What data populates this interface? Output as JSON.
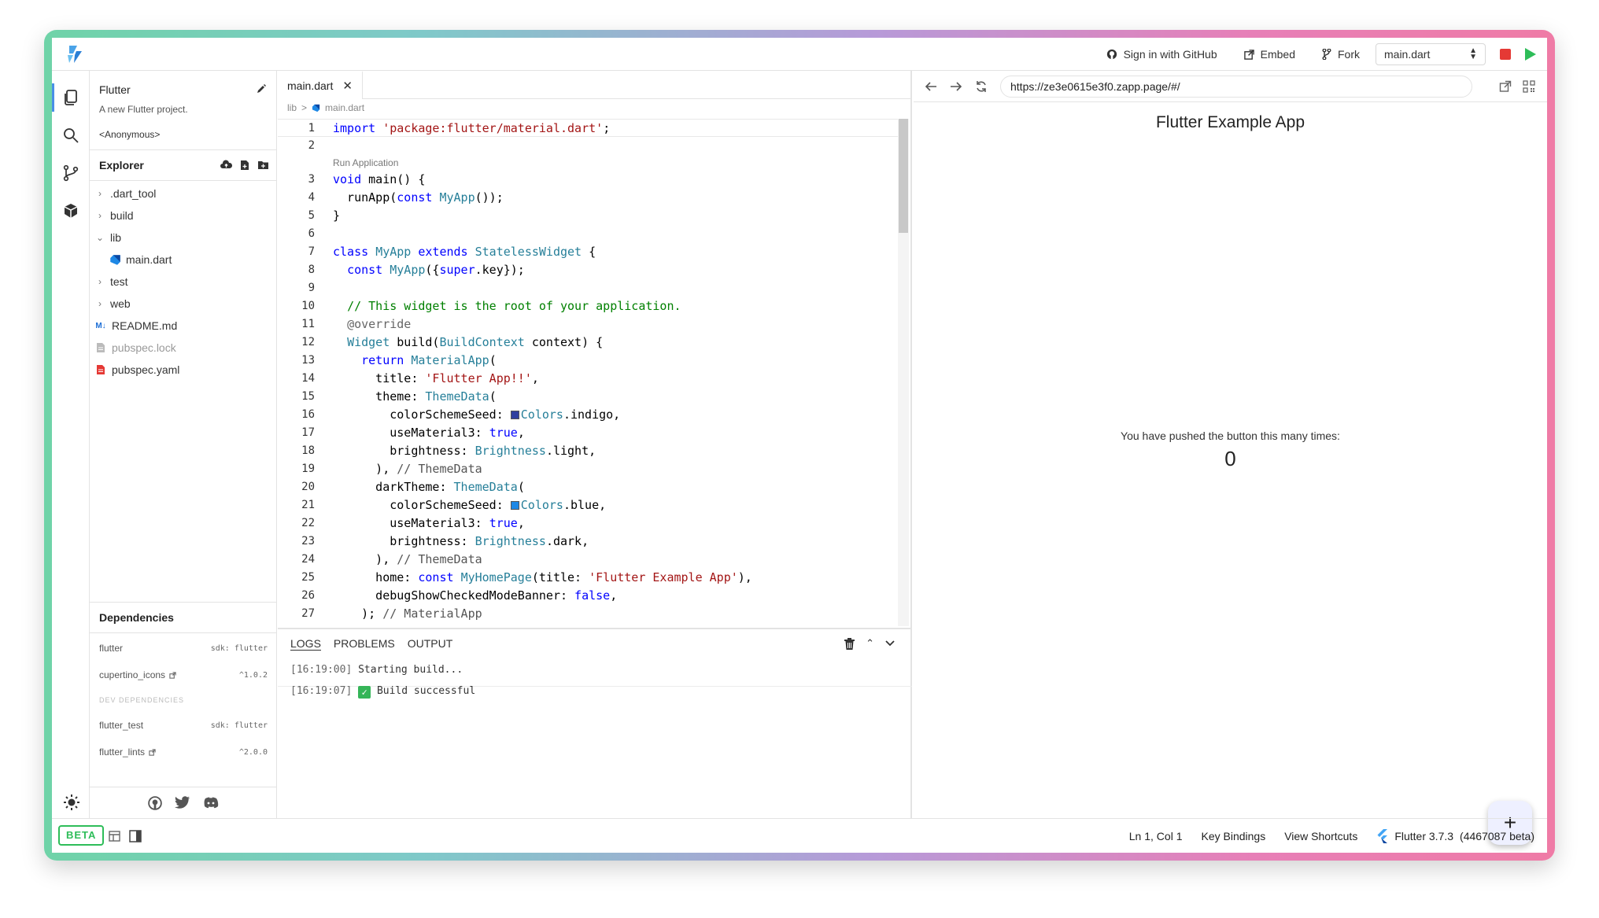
{
  "topbar": {
    "sign_in": "Sign in with GitHub",
    "embed": "Embed",
    "fork": "Fork",
    "file_select": "main.dart"
  },
  "sidebar": {
    "project_name": "Flutter",
    "project_desc": "A new Flutter project.",
    "author": "<Anonymous>",
    "explorer_label": "Explorer",
    "tree": [
      {
        "label": ".dart_tool",
        "kind": "folder",
        "expanded": false,
        "depth": 0,
        "dim": false
      },
      {
        "label": "build",
        "kind": "folder",
        "expanded": false,
        "depth": 0,
        "dim": false
      },
      {
        "label": "lib",
        "kind": "folder",
        "expanded": true,
        "depth": 0,
        "dim": false
      },
      {
        "label": "main.dart",
        "kind": "dart",
        "depth": 1,
        "dim": false
      },
      {
        "label": "test",
        "kind": "folder",
        "expanded": false,
        "depth": 0,
        "dim": false
      },
      {
        "label": "web",
        "kind": "folder",
        "expanded": false,
        "depth": 0,
        "dim": false
      },
      {
        "label": "README.md",
        "kind": "md",
        "depth": 0,
        "dim": false
      },
      {
        "label": "pubspec.lock",
        "kind": "lock",
        "depth": 0,
        "dim": true
      },
      {
        "label": "pubspec.yaml",
        "kind": "yaml",
        "depth": 0,
        "dim": false
      }
    ],
    "dependencies_label": "Dependencies",
    "dependencies": [
      {
        "name": "flutter",
        "version": "sdk: flutter",
        "external": false
      },
      {
        "name": "cupertino_icons",
        "version": "^1.0.2",
        "external": true
      }
    ],
    "dev_dependencies_label": "DEV DEPENDENCIES",
    "dev_dependencies": [
      {
        "name": "flutter_test",
        "version": "sdk: flutter",
        "external": false
      },
      {
        "name": "flutter_lints",
        "version": "^2.0.0",
        "external": true
      }
    ]
  },
  "editor": {
    "tab_label": "main.dart",
    "breadcrumb_folder": "lib",
    "breadcrumb_sep": ">",
    "breadcrumb_file": "main.dart",
    "codelens": "Run Application"
  },
  "panel": {
    "tabs": [
      "LOGS",
      "PROBLEMS",
      "OUTPUT"
    ],
    "logs": [
      {
        "time": "[16:19:00]",
        "text": "Starting build...",
        "check": false
      },
      {
        "time": "[16:19:07]",
        "text": "Build successful",
        "check": true
      }
    ]
  },
  "preview": {
    "url": "https://ze3e0615e3f0.zapp.page/#/",
    "app_title": "Flutter Example App",
    "message": "You have pushed the button this many times:",
    "count": "0",
    "fab_label": "+"
  },
  "status": {
    "beta": "BETA",
    "cursor": "Ln 1, Col 1",
    "key_bindings": "Key Bindings",
    "view_shortcuts": "View Shortcuts",
    "flutter_version": "Flutter 3.7.3",
    "flutter_build": "(4467087 beta)"
  },
  "colors": {
    "accent_green": "#2ebd59",
    "stop_red": "#e53935",
    "active_blue": "#4a8fe7",
    "indigo": "#303f9f",
    "blue": "#1e88e5"
  }
}
